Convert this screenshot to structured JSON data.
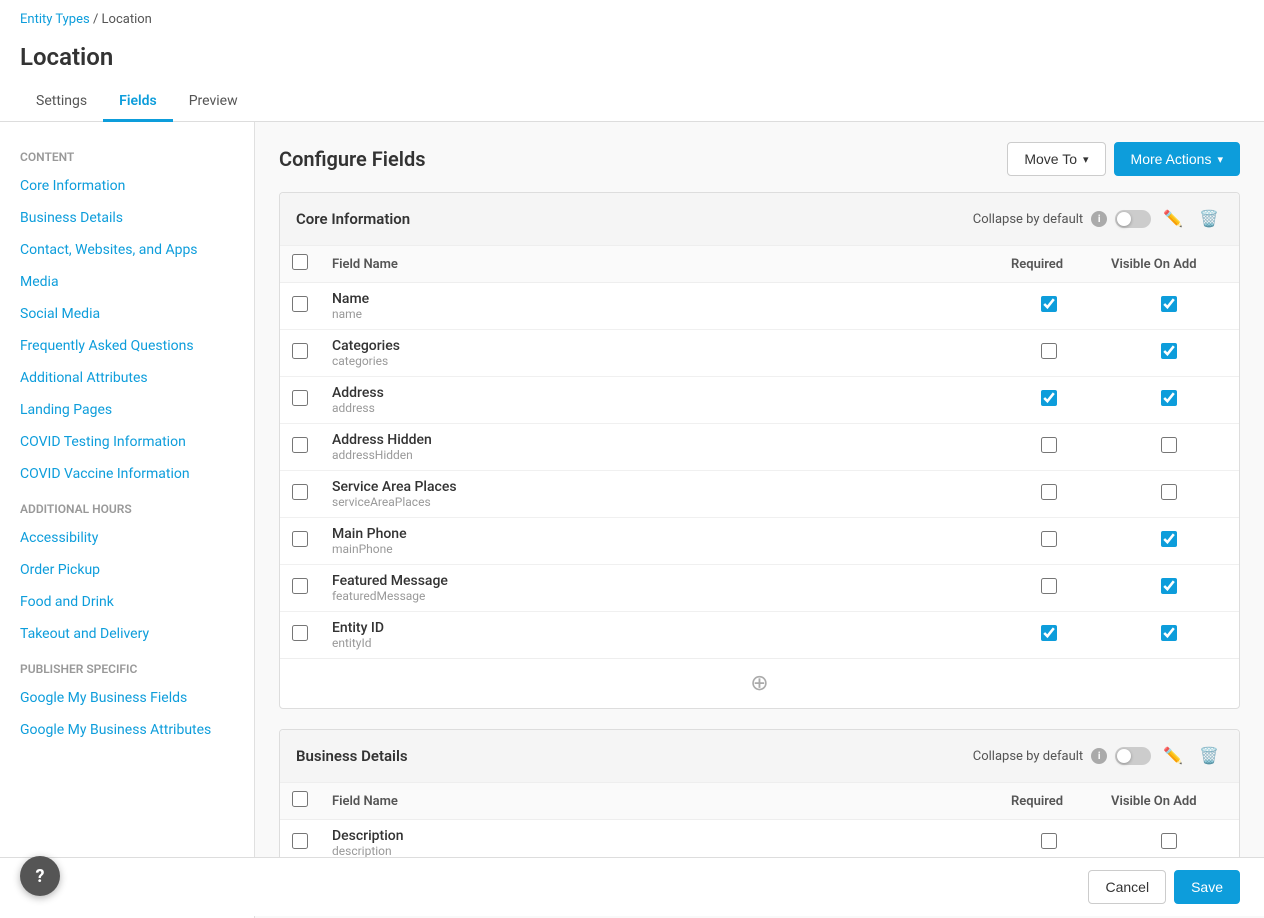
{
  "breadcrumb": {
    "parent_label": "Entity Types",
    "parent_href": "#",
    "separator": " / ",
    "current": "Location"
  },
  "page": {
    "title": "Location"
  },
  "tabs": [
    {
      "id": "settings",
      "label": "Settings",
      "active": false
    },
    {
      "id": "fields",
      "label": "Fields",
      "active": true
    },
    {
      "id": "preview",
      "label": "Preview",
      "active": false
    }
  ],
  "sidebar": {
    "sections": [
      {
        "label": "Content",
        "items": [
          "Core Information",
          "Business Details",
          "Contact, Websites, and Apps",
          "Media",
          "Social Media",
          "Frequently Asked Questions",
          "Additional Attributes",
          "Landing Pages",
          "COVID Testing Information",
          "COVID Vaccine Information"
        ]
      },
      {
        "label": "Additional Hours",
        "items": [
          "Accessibility",
          "Order Pickup",
          "Food and Drink",
          "Takeout and Delivery"
        ]
      },
      {
        "label": "Publisher Specific",
        "items": [
          "Google My Business Fields",
          "Google My Business Attributes"
        ]
      }
    ]
  },
  "configure_fields": {
    "title": "Configure Fields",
    "move_to_btn": "Move To",
    "more_actions_btn": "More Actions"
  },
  "sections": [
    {
      "id": "core-information",
      "title": "Core Information",
      "collapse_label": "Collapse by default",
      "toggle_on": false,
      "fields": [
        {
          "name": "Name",
          "key": "name",
          "required": true,
          "visible_on_add": true
        },
        {
          "name": "Categories",
          "key": "categories",
          "required": false,
          "visible_on_add": true
        },
        {
          "name": "Address",
          "key": "address",
          "required": true,
          "visible_on_add": true
        },
        {
          "name": "Address Hidden",
          "key": "addressHidden",
          "required": false,
          "visible_on_add": false
        },
        {
          "name": "Service Area Places",
          "key": "serviceAreaPlaces",
          "required": false,
          "visible_on_add": false
        },
        {
          "name": "Main Phone",
          "key": "mainPhone",
          "required": false,
          "visible_on_add": true
        },
        {
          "name": "Featured Message",
          "key": "featuredMessage",
          "required": false,
          "visible_on_add": true
        },
        {
          "name": "Entity ID",
          "key": "entityId",
          "required": true,
          "visible_on_add": true
        }
      ]
    },
    {
      "id": "business-details",
      "title": "Business Details",
      "collapse_label": "Collapse by default",
      "toggle_on": false,
      "fields": [
        {
          "name": "Description",
          "key": "description",
          "required": false,
          "visible_on_add": false
        }
      ]
    }
  ],
  "table_headers": {
    "field_name": "Field Name",
    "required": "Required",
    "visible_on_add": "Visible On Add"
  },
  "bottom_bar": {
    "cancel_label": "Cancel",
    "save_label": "Save"
  },
  "help_btn": "?"
}
